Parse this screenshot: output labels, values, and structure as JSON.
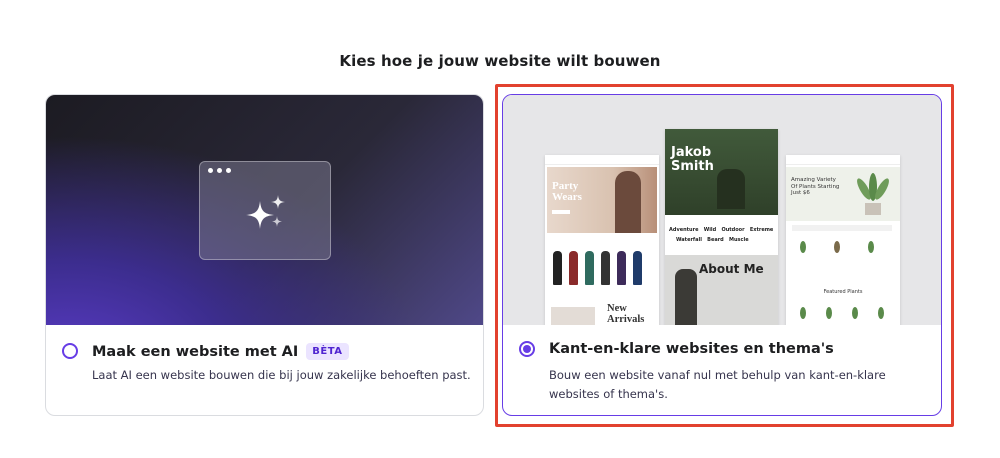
{
  "page": {
    "title": "Kies hoe je jouw website wilt bouwen"
  },
  "options": [
    {
      "title": "Maak een website met AI",
      "badge": "BÈTA",
      "description": "Laat AI een website bouwen die bij jouw zakelijke behoeften past.",
      "selected": false
    },
    {
      "title": "Kant-en-klare websites en thema's",
      "description": "Bouw een website vanaf nul met behulp van kant-en-klare websites of thema's.",
      "selected": true
    }
  ],
  "theme_preview": {
    "left_page": {
      "hero": "Party Wears",
      "section": "New Arrivals"
    },
    "center_page": {
      "hero": "Jakob Smith",
      "tags": [
        "Adventure",
        "Wild",
        "Outdoor",
        "Extreme",
        "Waterfall",
        "Beard",
        "Muscle"
      ],
      "section": "About Me"
    },
    "right_page": {
      "hero": "Amazing Variety Of Plants Starting Just $6",
      "section": "Featured Plants"
    }
  },
  "colors": {
    "accent": "#673de6",
    "highlight": "#e2412f",
    "badge_bg": "#ebe4ff"
  }
}
